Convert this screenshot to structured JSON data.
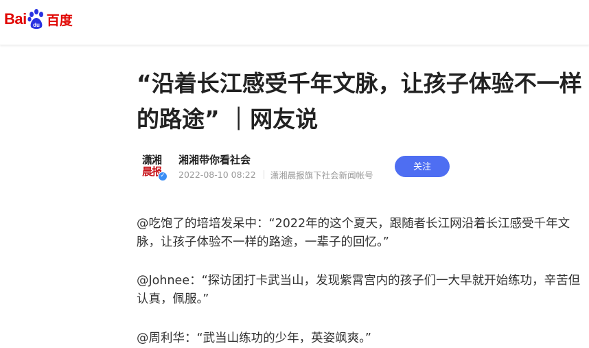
{
  "brand": {
    "logo_left": "Bai",
    "logo_mid": "du",
    "logo_right": "百度",
    "accent": "#e10602",
    "paw_color": "#2932e1"
  },
  "article": {
    "title": "“沿着长江感受千年文脉，让孩子体验不一样的路途” ｜网友说",
    "author": {
      "name": "湘湘带你看社会",
      "avatar_text_1": "潇湘",
      "avatar_text_2": "晨报",
      "date": "2022-08-10 08:22",
      "description": "潇湘晨报旗下社会新闻帐号"
    },
    "follow_label": "关注",
    "paragraphs": [
      "@吃饱了的培培发呆中：“2022年的这个夏天，跟随者长江网沿着长江感受千年文脉，让孩子体验不一样的路途，一辈子的回忆。”",
      "@Johnee：“探访团打卡武当山，发现紫霄宫内的孩子们一大早就开始练功，辛苦但认真，佩服。”",
      "@周利华：“武当山练功的少年，英姿飒爽。”"
    ]
  },
  "colors": {
    "follow_button": "#4e6ef2",
    "verified_badge": "#3b8ef5"
  }
}
